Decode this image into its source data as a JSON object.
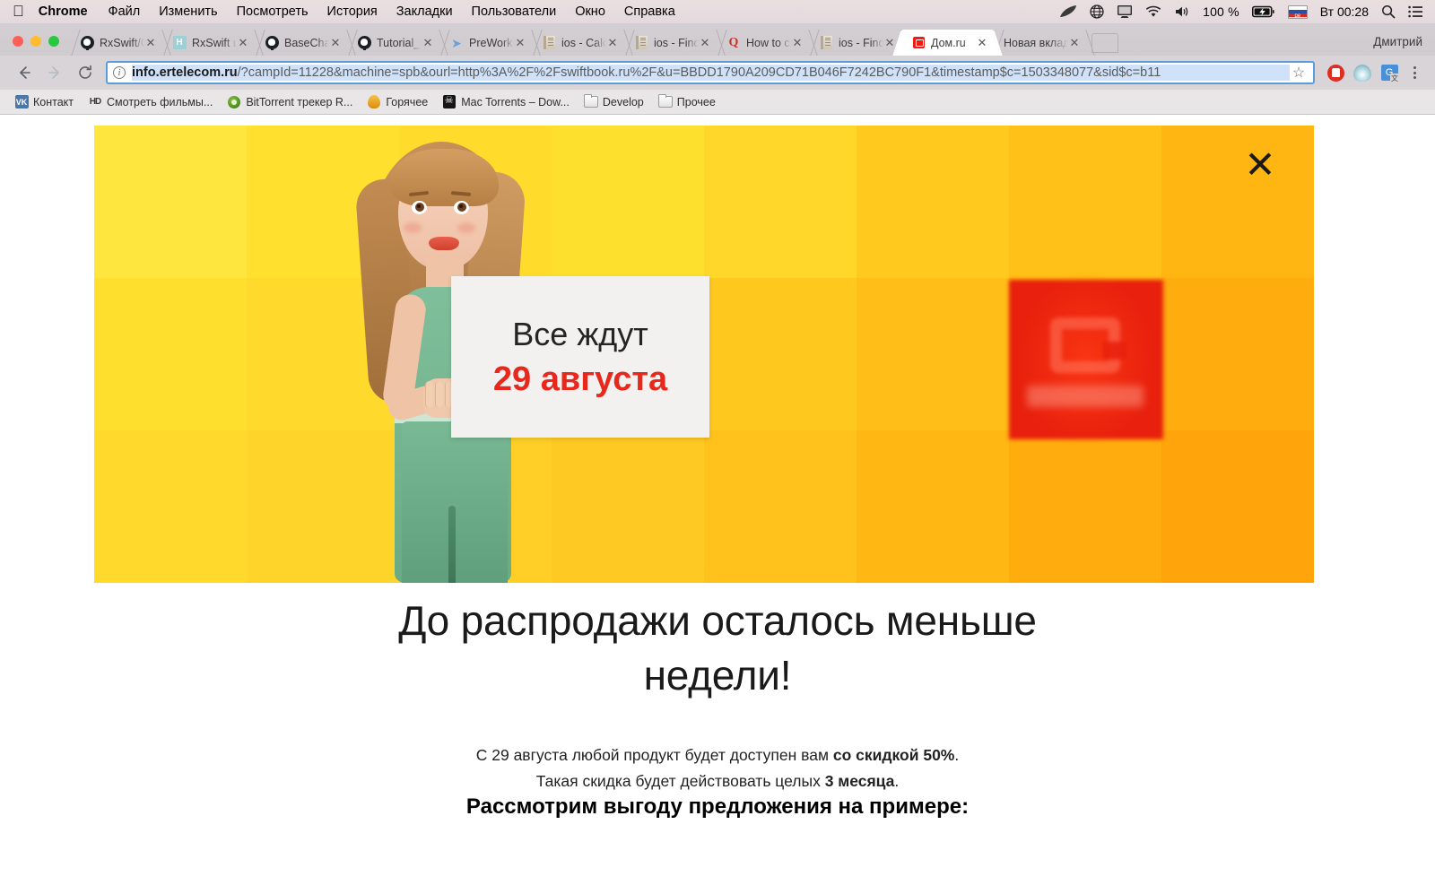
{
  "menubar": {
    "apple_icon": "apple-icon",
    "app_name": "Chrome",
    "items": [
      "Файл",
      "Изменить",
      "Посмотреть",
      "История",
      "Закладки",
      "Пользователи",
      "Окно",
      "Справка"
    ],
    "status": {
      "feather_icon": "feather-icon",
      "globe_icon": "globe-icon",
      "display_icon": "display-icon",
      "wifi_icon": "wifi-icon",
      "volume_icon": "volume-icon",
      "battery_percent": "100 %",
      "battery_icon": "battery-charging-icon",
      "flag_label": "ре",
      "clock": "Вт 00:28",
      "search_icon": "spotlight-search-icon",
      "notification_icon": "notification-center-icon"
    }
  },
  "tabs": [
    {
      "title": "RxSwift/Ge",
      "favicon": "github-icon",
      "active": false
    },
    {
      "title": "RxSwift шп",
      "favicon": "habr-icon",
      "active": false
    },
    {
      "title": "BaseChatV",
      "favicon": "github-icon",
      "active": false
    },
    {
      "title": "Tutorial_Se",
      "favicon": "github-icon",
      "active": false
    },
    {
      "title": "PreWorking",
      "favicon": "telegram-icon",
      "active": false
    },
    {
      "title": "ios - Calcu",
      "favicon": "stackoverflow-book-icon",
      "active": false
    },
    {
      "title": "ios - Findin",
      "favicon": "stackoverflow-book-icon",
      "active": false
    },
    {
      "title": "How to cre",
      "favicon": "quora-icon",
      "active": false
    },
    {
      "title": "ios - Findin",
      "favicon": "stackoverflow-book-icon",
      "active": false
    },
    {
      "title": "Дом.ru",
      "favicon": "domru-icon",
      "active": true
    },
    {
      "title": "Новая вкладк",
      "favicon": "none",
      "active": false
    }
  ],
  "tab_close_label": "✕",
  "new_tab_label": "new-tab-button",
  "profile_name": "Дмитрий",
  "toolbar": {
    "back_label": "←",
    "forward_label": "→",
    "reload_label": "⟳",
    "page_info_label": "i",
    "url_domain": "info.ertelecom.ru",
    "url_path": "/?campId=11228&machine=spb&ourl=http%3A%2F%2Fswiftbook.ru%2F&u=BBDD1790A209CD71B046F7242BC790F1&timestamp$c=1503348077&sid$c=b11",
    "bookmark_star_label": "☆",
    "extensions": [
      "adblock-icon",
      "water-drop-icon",
      "google-translate-icon"
    ],
    "menu_label": "chrome-menu-icon"
  },
  "bookmarks": [
    {
      "label": "Контакт",
      "icon": "vk-icon"
    },
    {
      "label": "Смотреть фильмы...",
      "icon": "hd-icon"
    },
    {
      "label": "BitTorrent трекер R...",
      "icon": "bittorrent-icon"
    },
    {
      "label": "Горячее",
      "icon": "fire-icon"
    },
    {
      "label": "Mac Torrents – Dow...",
      "icon": "skull-icon"
    },
    {
      "label": "Develop",
      "icon": "folder-icon"
    },
    {
      "label": "Прочее",
      "icon": "folder-icon"
    }
  ],
  "page": {
    "close_banner_label": "✕",
    "sign": {
      "line1": "Все ждут",
      "line2": "29 августа"
    },
    "logo_alt": "domru-logo",
    "headline": "До распродажи осталось меньше недели!",
    "sub_line1_pre": "С 29 августа любой продукт будет доступен вам ",
    "sub_line1_bold": "со скидкой 50%",
    "sub_line1_post": ".",
    "sub_line2_pre": "Такая скидка будет действовать целых ",
    "sub_line2_bold": "3 месяца",
    "sub_line2_post": ".",
    "subheadline": "Рассмотрим выгоду предложения на примере:"
  },
  "colors": {
    "accent_red": "#e8281c",
    "logo_red": "#e8200d",
    "omnibox_border": "#5b9dd9",
    "hero_tiles": [
      [
        "#ffe63f",
        "#ffe02e",
        "#ffdc2b",
        "#fde02d",
        "#ffd62a",
        "#ffc91e",
        "#ffc117",
        "#ffb612"
      ],
      [
        "#ffdf2d",
        "#ffd92c",
        "#fdd429",
        "#fccd26",
        "#ffc81f",
        "#ffbf18",
        "#ffb512",
        "#ffac0e"
      ],
      [
        "#ffd92b",
        "#ffd42a",
        "#ffcf28",
        "#ffc924",
        "#ffc11c",
        "#ffb714",
        "#ffad0e",
        "#ffa50b"
      ]
    ]
  }
}
